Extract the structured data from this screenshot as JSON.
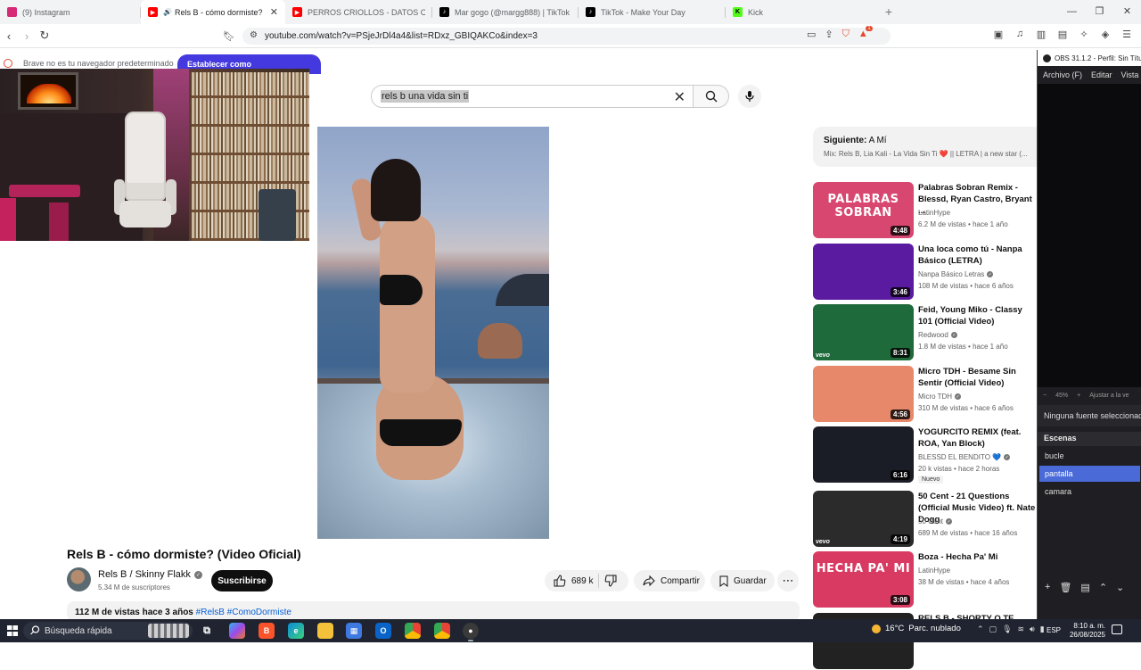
{
  "browser": {
    "tabs": [
      {
        "label": "(9) Instagram",
        "active": false
      },
      {
        "label": "Rels B - cómo dormiste? (Vide",
        "active": true
      },
      {
        "label": "PERROS CRIOLLOS - DATOS CURIOS",
        "active": false
      },
      {
        "label": "Mar gogo (@margg888) | TikTok",
        "active": false
      },
      {
        "label": "TikTok - Make Your Day",
        "active": false
      },
      {
        "label": "Kick",
        "active": false
      }
    ],
    "url": "youtube.com/watch?v=PSjeJrDl4a4&list=RDxz_GBIQAKCo&index=3",
    "new_tab": "+",
    "win_min": "—",
    "win_max": "❐",
    "win_close": "✕",
    "brave_badge": "1"
  },
  "infobar": {
    "message": "Brave no es tu navegador predeterminado",
    "button": "Establecer como predeterminado"
  },
  "search": {
    "query": "rels b una vida sin ti"
  },
  "video": {
    "title": "Rels B - cómo dormiste? (Video Oficial)",
    "channel": "Rels B / Skinny Flakk",
    "subscribers": "5.34 M de suscriptores",
    "subscribe_label": "Suscribirse",
    "likes": "689 k",
    "share_label": "Compartir",
    "save_label": "Guardar",
    "views": "112 M de vistas",
    "age": "hace 3 años",
    "hashtags": "#RelsB #ComoDormiste"
  },
  "playlist": {
    "next_label": "Siguiente:",
    "next_title": "A Mí",
    "mix_title": "Mix: Rels B, Lia Kali - La Vida Sin Ti ❤️ || LETRA | a new star (..."
  },
  "recommendations": [
    {
      "title": "Palabras Sobran Remix - Blessd, Ryan Castro, Bryant ...",
      "channel": "LatinHype",
      "verified": false,
      "views": "6.2 M de vistas",
      "age": "hace 1 año",
      "duration": "4:48",
      "thumb_text": "PALABRAS SOBRAN",
      "thumb_color": "#d8476f",
      "vevo": false,
      "is_new": false
    },
    {
      "title": "Una loca como tú - Nanpa Básico (LETRA)",
      "channel": "Nanpa Básico Letras",
      "verified": true,
      "views": "108 M de vistas",
      "age": "hace 6 años",
      "duration": "3:46",
      "thumb_text": "",
      "thumb_color": "#5a1ba0",
      "vevo": false,
      "is_new": false
    },
    {
      "title": "Feid, Young Miko - Classy 101 (Official Video)",
      "channel": "Redwood",
      "verified": true,
      "views": "1.8 M de vistas",
      "age": "hace 1 año",
      "duration": "8:31",
      "thumb_text": "",
      "thumb_color": "#1f6a3a",
      "vevo": true,
      "is_new": false
    },
    {
      "title": "Micro TDH - Besame Sin Sentir (Official Video)",
      "channel": "Micro TDH",
      "verified": true,
      "views": "310 M de vistas",
      "age": "hace 6 años",
      "duration": "4:56",
      "thumb_text": "",
      "thumb_color": "#e8886a",
      "vevo": false,
      "is_new": false
    },
    {
      "title": "YOGURCITO REMIX (feat. ROA, Yan Block)",
      "channel": "BLESSD EL BENDITO 💙",
      "verified": true,
      "views": "20 k vistas",
      "age": "hace 2 horas",
      "duration": "6:16",
      "thumb_text": "",
      "thumb_color": "#1a1d26",
      "vevo": false,
      "is_new": true,
      "new_label": "Nuevo"
    },
    {
      "title": "50 Cent - 21 Questions (Official Music Video) ft. Nate Dogg",
      "channel": "50 Cent",
      "verified": true,
      "views": "689 M de vistas",
      "age": "hace 16 años",
      "duration": "4:19",
      "thumb_text": "",
      "thumb_color": "#2b2b2b",
      "vevo": true,
      "is_new": false
    },
    {
      "title": "Boza - Hecha Pa' Mi",
      "channel": "LatinHype",
      "verified": false,
      "views": "38 M de vistas",
      "age": "hace 4 años",
      "duration": "3:08",
      "thumb_text": "HECHA PA' MI",
      "thumb_color": "#d83a62",
      "vevo": false,
      "is_new": false
    },
    {
      "title": "RELS B - SHORTY O TE VAYA",
      "channel": "",
      "verified": false,
      "views": "",
      "age": "",
      "duration": "",
      "thumb_text": "",
      "thumb_color": "#222222",
      "vevo": false,
      "is_new": false
    }
  ],
  "obs": {
    "title": "OBS 31.1.2 - Perfil: Sin Títu",
    "menu": [
      "Archivo (F)",
      "Editar",
      "Vista"
    ],
    "zoom": "45%",
    "zoom_fit": "Ajustar a la ve",
    "no_source": "Ninguna fuente seleccionada",
    "scenes_header": "Escenas",
    "scenes": [
      {
        "name": "bucle",
        "selected": false
      },
      {
        "name": "pantalla",
        "selected": true
      },
      {
        "name": "camara",
        "selected": false
      }
    ]
  },
  "taskbar": {
    "search_placeholder": "Búsqueda rápida",
    "weather_temp": "16°C",
    "weather_desc": "Parc. nublado",
    "language": "ESP",
    "time": "8:10 a. m.",
    "date": "26/08/2025"
  }
}
